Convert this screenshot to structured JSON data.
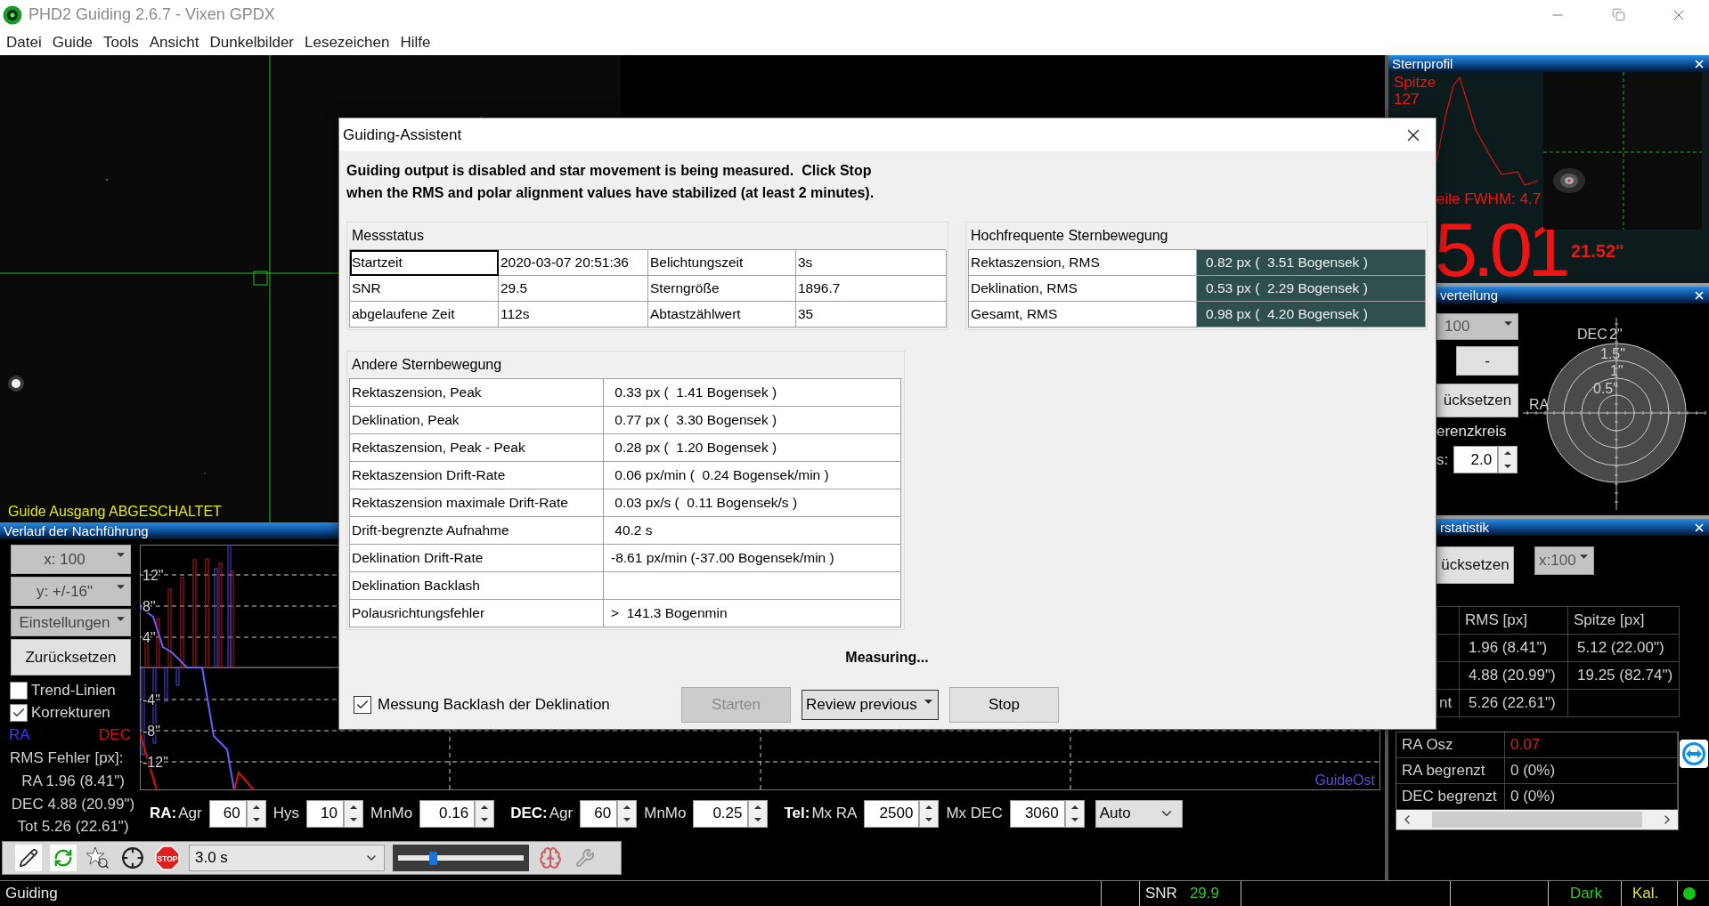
{
  "window": {
    "title": "PHD2 Guiding 2.6.7 - Vixen GPDX"
  },
  "menu": [
    "Datei",
    "Guide",
    "Tools",
    "Ansicht",
    "Dunkelbilder",
    "Lesezeichen",
    "Hilfe"
  ],
  "camera": {
    "status": "Guide Ausgang ABGESCHALTET"
  },
  "graph": {
    "title": "Verlauf der Nachführung",
    "buttons": [
      {
        "label": "x: 100",
        "kind": "dropdown"
      },
      {
        "label": "y: +/-16\"",
        "kind": "dropdown"
      },
      {
        "label": "Einstellungen",
        "kind": "dropdown"
      },
      {
        "label": "Zurücksetzen",
        "kind": "button"
      }
    ],
    "checkboxes": [
      {
        "label": "Trend-Linien",
        "checked": false
      },
      {
        "label": "Korrekturen",
        "checked": true
      }
    ],
    "legend": [
      "RA",
      "DEC"
    ],
    "rms_title": "RMS Fehler [px]:",
    "rms": [
      "RA 1.96 (8.41\")",
      "DEC 4.88 (20.99\")",
      "Tot 5.26 (22.61\")"
    ],
    "y_ticks": [
      "12\"",
      "8\"",
      "4\"",
      "-4\"",
      "-8\"",
      "-12\""
    ],
    "direction": "GuideOst"
  },
  "params": {
    "groups": [
      {
        "label": "RA:",
        "fields": [
          {
            "label": "Agr",
            "value": "60"
          },
          {
            "label": "Hys",
            "value": "10"
          },
          {
            "label": "MnMo",
            "value": "0.16"
          }
        ]
      },
      {
        "label": "DEC:",
        "fields": [
          {
            "label": "Agr",
            "value": "60"
          },
          {
            "label": "MnMo",
            "value": "0.25"
          }
        ]
      },
      {
        "label": "Tel:",
        "fields": [
          {
            "label": "Mx RA",
            "value": "2500"
          },
          {
            "label": "Mx DEC",
            "value": "3060"
          }
        ]
      }
    ],
    "mode": "Auto"
  },
  "toolbar": {
    "stop_sign": "STOP",
    "exposure": "3.0 s",
    "level": 0.28
  },
  "star_profile": {
    "title": "Sternprofil",
    "peak_label": "Spitze",
    "peak": "127",
    "fwhm": "eile FWHM: 4.7",
    "hfd": "5.01",
    "hfd_arcsec": "21.52\""
  },
  "target": {
    "title": "verteilung",
    "zoom": "100",
    "minus": "-",
    "reset": "ücksetzen",
    "circle_label": "erenzkreis",
    "radius_label": "s:",
    "radius": "2.0",
    "axis_dec": "DEC",
    "axis_ra": "RA",
    "rings": [
      "2\"",
      "1.5\"",
      "1\"",
      "0.5\""
    ]
  },
  "stats": {
    "title": "rstatistik",
    "reset": "ücksetzen",
    "range": "x:100",
    "columns": [
      "RMS [px]",
      "Spitze [px]"
    ],
    "rows": [
      {
        "rms": "1.96 (8.41\")",
        "peak": "5.12 (22.00\")"
      },
      {
        "rms": "4.88 (20.99\")",
        "peak": "19.25 (82.74\")"
      },
      {
        "label": "nt",
        "rms": "5.26 (22.61\")"
      }
    ],
    "osc": [
      {
        "label": "RA Osz",
        "value": "0.07",
        "warning": true
      },
      {
        "label": "RA begrenzt",
        "value": "0 (0%)",
        "warning": false
      },
      {
        "label": "DEC begrenzt",
        "value": "0 (0%)",
        "warning": false
      }
    ]
  },
  "dialog": {
    "title": "Guiding-Assistent",
    "intro": "Guiding output is disabled and star movement is being measured.  Click Stop\nwhen the RMS and polar alignment values have stabilized (at least 2 minutes).",
    "status_group": "Messstatus",
    "status_rows": [
      {
        "cells": [
          "Startzeit",
          "2020-03-07 20:51:36",
          "Belichtungszeit",
          "3s"
        ],
        "focused": true
      },
      {
        "cells": [
          "SNR",
          "29.5",
          "Sterngröße",
          "1896.7"
        ],
        "focused": false
      },
      {
        "cells": [
          "abgelaufene Zeit",
          "112s",
          "Abtastzählwert",
          "35"
        ],
        "focused": false
      }
    ],
    "hf_group": "Hochfrequente Sternbewegung",
    "hf_rows": [
      {
        "label": "Rektaszension, RMS",
        "value": "0.82 px (  3.51 Bogensek )"
      },
      {
        "label": "Deklination, RMS",
        "value": "0.53 px (  2.29 Bogensek )"
      },
      {
        "label": "Gesamt, RMS",
        "value": "0.98 px (  4.20 Bogensek )"
      }
    ],
    "other_group": "Andere Sternbewegung",
    "other_rows": [
      {
        "label": "Rektaszension, Peak",
        "value": " 0.33 px (  1.41 Bogensek )"
      },
      {
        "label": "Deklination, Peak",
        "value": " 0.77 px (  3.30 Bogensek )"
      },
      {
        "label": "Rektaszension, Peak - Peak",
        "value": " 0.28 px (  1.20 Bogensek )"
      },
      {
        "label": "Rektaszension Drift-Rate",
        "value": " 0.06 px/min (  0.24 Bogensek/min )"
      },
      {
        "label": "Rektaszension maximale Drift-Rate",
        "value": " 0.03 px/s (  0.11 Bogensek/s )"
      },
      {
        "label": "Drift-begrenzte Aufnahme",
        "value": " 40.2 s"
      },
      {
        "label": "Deklination Drift-Rate",
        "value": "-8.61 px/min (-37.00 Bogensek/min )"
      },
      {
        "label": "Deklination Backlash"
      },
      {
        "label": "Polausrichtungsfehler",
        "value": ">  141.3 Bogenmin"
      }
    ],
    "measuring": "Measuring...",
    "backlash": {
      "label": "Messung Backlash der Deklination",
      "checked": true
    },
    "buttons": [
      {
        "label": "Starten",
        "kind": "button",
        "disabled": true
      },
      {
        "label": "Review previous",
        "kind": "dropdown",
        "disabled": false
      },
      {
        "label": "Stop",
        "kind": "button",
        "disabled": false
      }
    ]
  },
  "status_bar": {
    "status": "Guiding",
    "snr_label": "SNR",
    "snr": "29.9",
    "dark": "Dark",
    "cal": "Kal.",
    "connected": true
  }
}
